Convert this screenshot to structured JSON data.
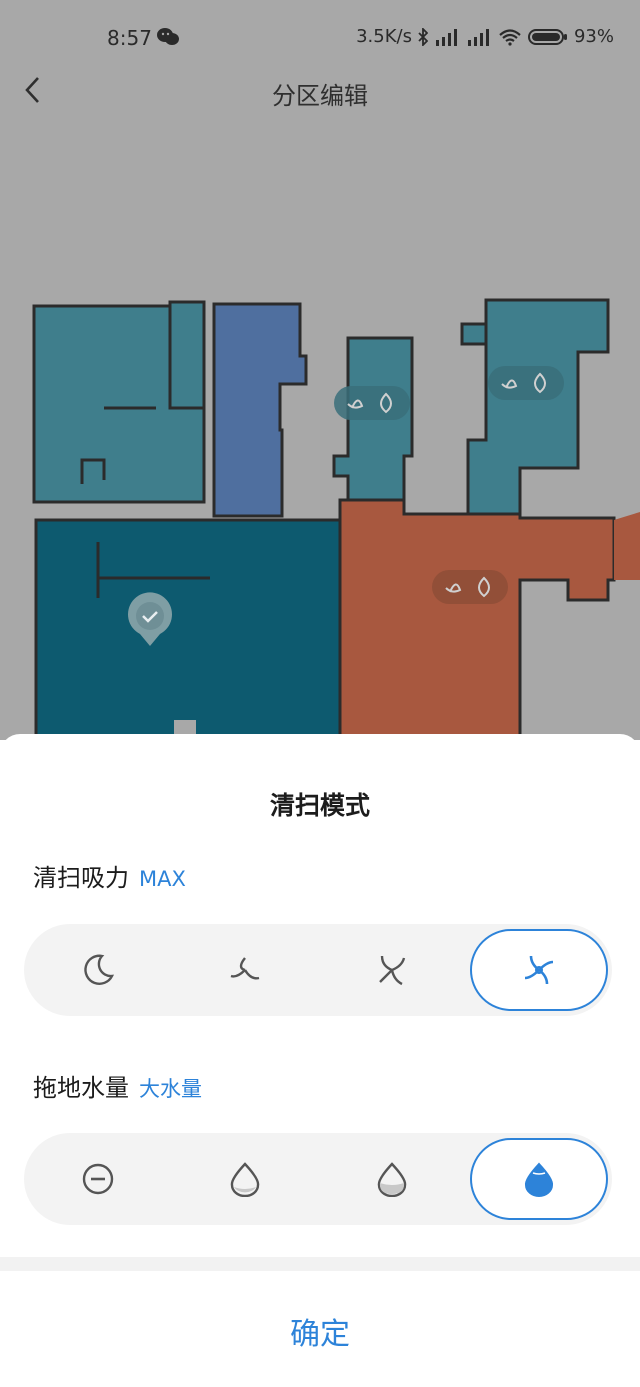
{
  "status_bar": {
    "time": "8:57",
    "speed": "3.5K/s",
    "battery": "93%",
    "icons": [
      "wechat-icon",
      "bluetooth-icon",
      "signal-hd-icon",
      "signal-hd-icon",
      "wifi-icon",
      "battery-icon"
    ]
  },
  "header": {
    "title": "分区编辑",
    "back_icon": "chevron-left-icon"
  },
  "map": {
    "room_badges": [
      "fan-water-badge",
      "fan-water-badge",
      "fan-water-badge"
    ],
    "selected_room_marker": "check-pin-icon"
  },
  "sheet": {
    "title": "清扫模式",
    "suction": {
      "label": "清扫吸力",
      "value": "MAX",
      "options": [
        "moon-quiet-icon",
        "fan-standard-icon",
        "fan-strong-icon",
        "fan-max-icon"
      ],
      "selected_index": 3
    },
    "water": {
      "label": "拖地水量",
      "value": "大水量",
      "options": [
        "water-off-icon",
        "drop-low-icon",
        "drop-medium-icon",
        "drop-high-icon"
      ],
      "selected_index": 3
    },
    "confirm_label": "确定"
  },
  "colors": {
    "accent": "#2d83d9",
    "overlay": "#a8a8a8",
    "room_teal_light": "#3f7e8c",
    "room_blue": "#4f6f9f",
    "room_teal_dark": "#0d5a6f",
    "room_orange": "#a8583f"
  }
}
